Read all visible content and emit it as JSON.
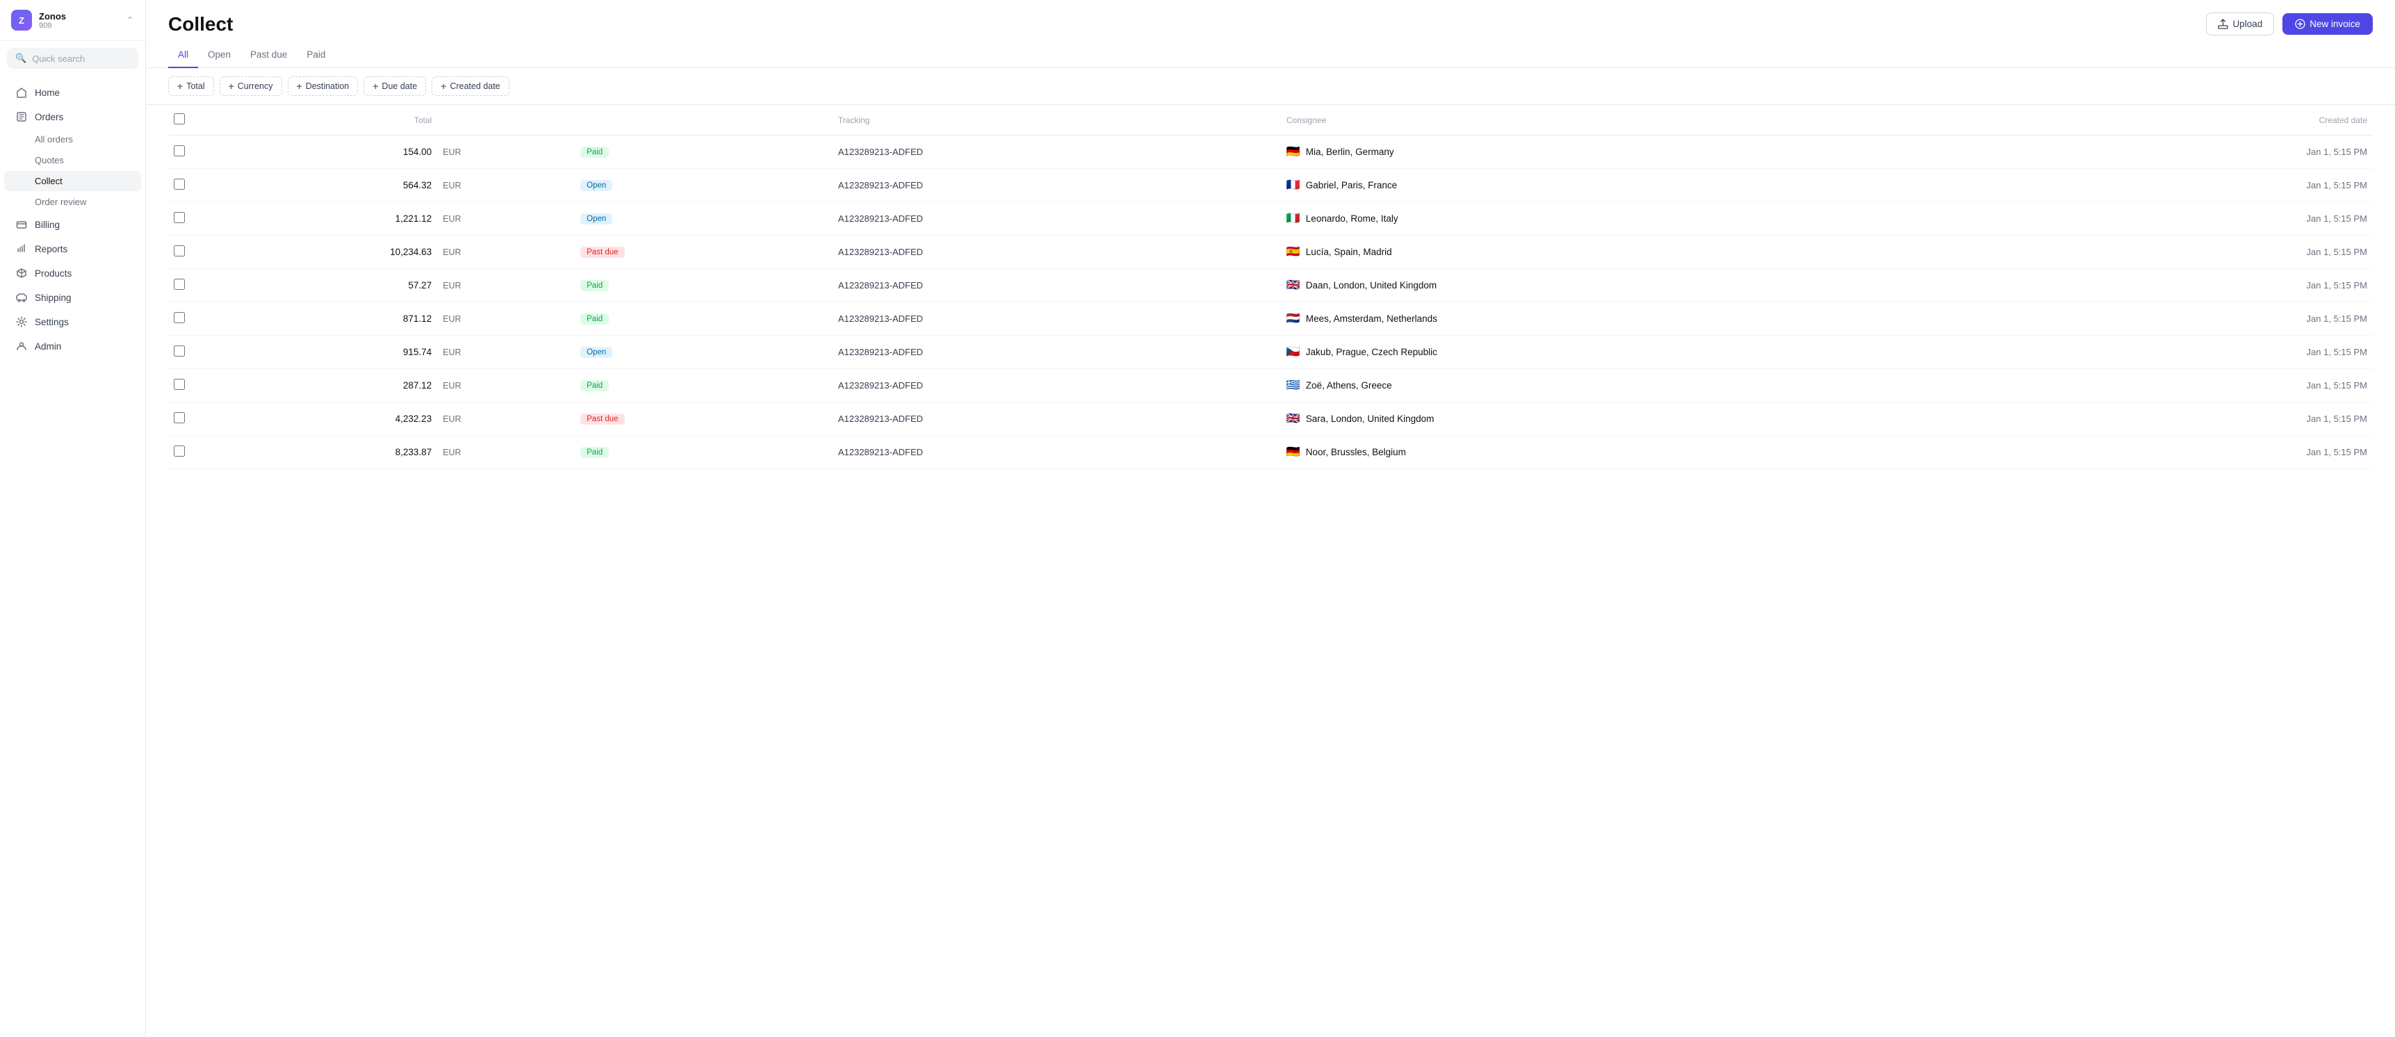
{
  "app": {
    "org_name": "Zonos",
    "org_id": "909",
    "avatar_text": "Z"
  },
  "sidebar": {
    "search_placeholder": "Quick search",
    "nav_items": [
      {
        "id": "home",
        "label": "Home",
        "icon": "home"
      },
      {
        "id": "orders",
        "label": "Orders",
        "icon": "orders",
        "expanded": true,
        "sub_items": [
          {
            "id": "all-orders",
            "label": "All orders"
          },
          {
            "id": "quotes",
            "label": "Quotes"
          },
          {
            "id": "collect",
            "label": "Collect",
            "active": true
          },
          {
            "id": "order-review",
            "label": "Order review"
          }
        ]
      },
      {
        "id": "billing",
        "label": "Billing",
        "icon": "billing"
      },
      {
        "id": "reports",
        "label": "Reports",
        "icon": "reports"
      },
      {
        "id": "products",
        "label": "Products",
        "icon": "products"
      },
      {
        "id": "shipping",
        "label": "Shipping",
        "icon": "shipping"
      },
      {
        "id": "settings",
        "label": "Settings",
        "icon": "settings"
      },
      {
        "id": "admin",
        "label": "Admin",
        "icon": "admin"
      }
    ]
  },
  "page": {
    "title": "Collect",
    "upload_label": "Upload",
    "new_invoice_label": "New invoice"
  },
  "tabs": [
    {
      "id": "all",
      "label": "All",
      "active": true
    },
    {
      "id": "open",
      "label": "Open"
    },
    {
      "id": "past-due",
      "label": "Past due"
    },
    {
      "id": "paid",
      "label": "Paid"
    }
  ],
  "filters": [
    {
      "id": "total",
      "label": "Total"
    },
    {
      "id": "currency",
      "label": "Currency"
    },
    {
      "id": "destination",
      "label": "Destination"
    },
    {
      "id": "due-date",
      "label": "Due date"
    },
    {
      "id": "created-date",
      "label": "Created date"
    }
  ],
  "table": {
    "columns": [
      {
        "id": "total",
        "label": "Total",
        "align": "right"
      },
      {
        "id": "currency",
        "label": ""
      },
      {
        "id": "status",
        "label": ""
      },
      {
        "id": "tracking",
        "label": "Tracking"
      },
      {
        "id": "consignee",
        "label": "Consignee"
      },
      {
        "id": "created_date",
        "label": "Created date",
        "align": "right"
      }
    ],
    "rows": [
      {
        "id": 1,
        "total": "154.00",
        "currency": "EUR",
        "status": "Paid",
        "status_type": "paid",
        "tracking": "A123289213-ADFED",
        "flag": "🇩🇪",
        "consignee": "Mia, Berlin, Germany",
        "created_date": "Jan 1, 5:15 PM"
      },
      {
        "id": 2,
        "total": "564.32",
        "currency": "EUR",
        "status": "Open",
        "status_type": "open",
        "tracking": "A123289213-ADFED",
        "flag": "🇫🇷",
        "consignee": "Gabriel, Paris, France",
        "created_date": "Jan 1, 5:15 PM"
      },
      {
        "id": 3,
        "total": "1,221.12",
        "currency": "EUR",
        "status": "Open",
        "status_type": "open",
        "tracking": "A123289213-ADFED",
        "flag": "🇮🇹",
        "consignee": "Leonardo, Rome, Italy",
        "created_date": "Jan 1, 5:15 PM"
      },
      {
        "id": 4,
        "total": "10,234.63",
        "currency": "EUR",
        "status": "Past due",
        "status_type": "past-due",
        "tracking": "A123289213-ADFED",
        "flag": "🇪🇸",
        "consignee": "Lucía, Spain, Madrid",
        "created_date": "Jan 1, 5:15 PM"
      },
      {
        "id": 5,
        "total": "57.27",
        "currency": "EUR",
        "status": "Paid",
        "status_type": "paid",
        "tracking": "A123289213-ADFED",
        "flag": "🇬🇧",
        "consignee": "Daan, London, United Kingdom",
        "created_date": "Jan 1, 5:15 PM"
      },
      {
        "id": 6,
        "total": "871.12",
        "currency": "EUR",
        "status": "Paid",
        "status_type": "paid",
        "tracking": "A123289213-ADFED",
        "flag": "🇳🇱",
        "consignee": "Mees, Amsterdam, Netherlands",
        "created_date": "Jan 1, 5:15 PM"
      },
      {
        "id": 7,
        "total": "915.74",
        "currency": "EUR",
        "status": "Open",
        "status_type": "open",
        "tracking": "A123289213-ADFED",
        "flag": "🇨🇿",
        "consignee": "Jakub, Prague, Czech Republic",
        "created_date": "Jan 1, 5:15 PM"
      },
      {
        "id": 8,
        "total": "287.12",
        "currency": "EUR",
        "status": "Paid",
        "status_type": "paid",
        "tracking": "A123289213-ADFED",
        "flag": "🇬🇷",
        "consignee": "Zoë, Athens, Greece",
        "created_date": "Jan 1, 5:15 PM"
      },
      {
        "id": 9,
        "total": "4,232.23",
        "currency": "EUR",
        "status": "Past due",
        "status_type": "past-due",
        "tracking": "A123289213-ADFED",
        "flag": "🇬🇧",
        "consignee": "Sara,  London, United Kingdom",
        "created_date": "Jan 1, 5:15 PM"
      },
      {
        "id": 10,
        "total": "8,233.87",
        "currency": "EUR",
        "status": "Paid",
        "status_type": "paid",
        "tracking": "A123289213-ADFED",
        "flag": "🇩🇪",
        "consignee": "Noor, Brussles, Belgium",
        "created_date": "Jan 1, 5:15 PM"
      }
    ]
  }
}
